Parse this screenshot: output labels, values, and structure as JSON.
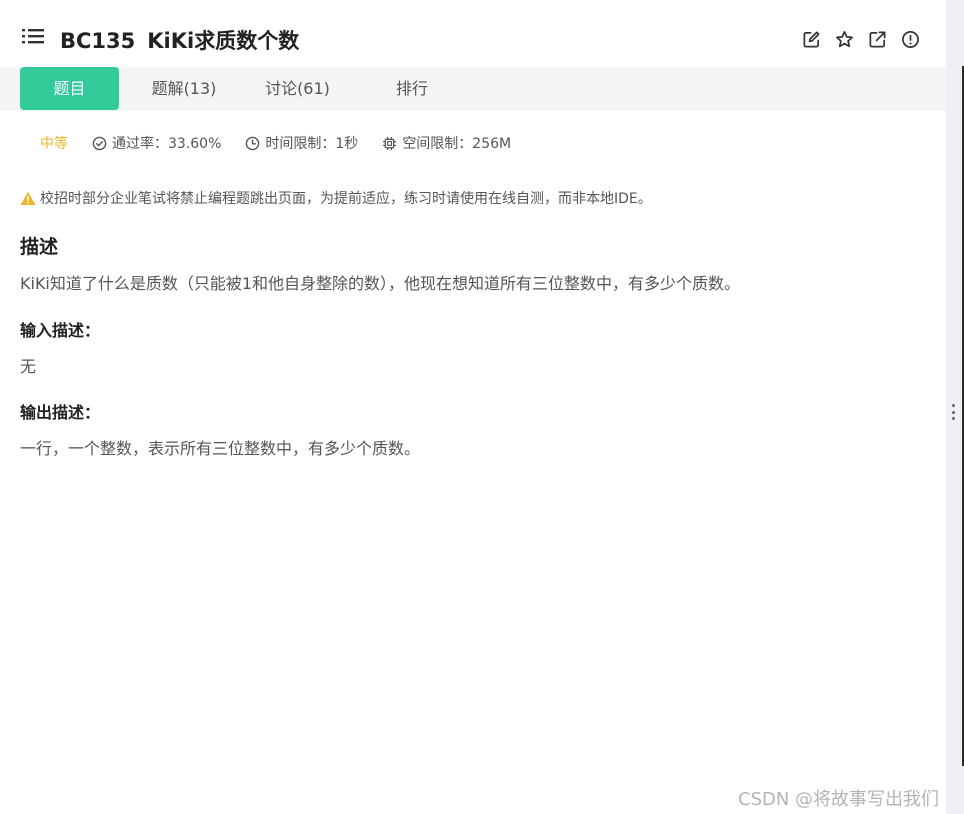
{
  "header": {
    "problem_code": "BC135",
    "problem_title": "KiKi求质数个数",
    "icons": [
      "list-menu-icon",
      "edit-icon",
      "star-icon",
      "external-link-icon",
      "alert-circle-icon"
    ]
  },
  "tabs": [
    {
      "label": "题目",
      "active": true
    },
    {
      "label": "题解(13)",
      "active": false
    },
    {
      "label": "讨论(61)",
      "active": false
    },
    {
      "label": "排行",
      "active": false
    }
  ],
  "meta": {
    "difficulty": "中等",
    "difficulty_color": "#f0b52a",
    "pass_rate": "通过率：33.60%",
    "time_limit": "时间限制：1秒",
    "memory_limit": "空间限制：256M"
  },
  "notice": "校招时部分企业笔试将禁止编程题跳出页面，为提前适应，练习时请使用在线自测，而非本地IDE。",
  "description": {
    "title": "描述",
    "text": "KiKi知道了什么是质数（只能被1和他自身整除的数），他现在想知道所有三位整数中，有多少个质数。"
  },
  "input_desc": {
    "title": "输入描述：",
    "text": "无"
  },
  "output_desc": {
    "title": "输出描述：",
    "text": "一行，一个整数，表示所有三位整数中，有多少个质数。"
  },
  "watermark": "CSDN @将故事写出我们",
  "colors": {
    "accent": "#32ca99",
    "warning": "#f0b52a"
  }
}
